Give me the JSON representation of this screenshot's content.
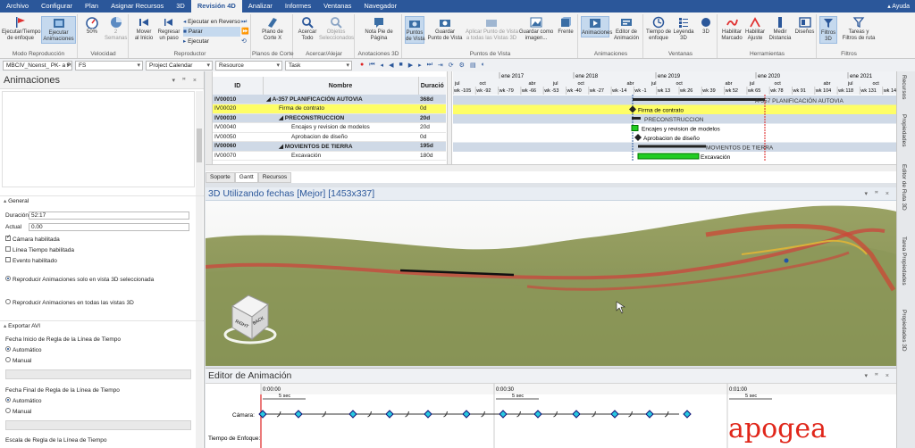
{
  "menu": {
    "items": [
      "Archivo",
      "Configurar",
      "Plan",
      "Asignar Recursos",
      "3D",
      "Revisión 4D",
      "Analizar",
      "Informes",
      "Ventanas",
      "Navegador"
    ],
    "active": "Revisión 4D",
    "help": "▴ Ayuda"
  },
  "ribbon": {
    "groups": {
      "modo": "Modo Reproducción",
      "velocidad": "Velocidad",
      "reproductor": "Reproductor",
      "planos": "Planos de Corte",
      "acercar": "Acercar/Alejar",
      "anotaciones": "Anotaciones 3D",
      "puntos": "Puntos de Vista",
      "animaciones": "Animaciones",
      "ventanas": "Ventanas",
      "herramientas": "Herramientas",
      "filtros": "Filtros"
    },
    "buttons": {
      "ejecutar_enfoque": "Ejecutar/Tiempo\nde enfoque",
      "ejecutar_anim": "Ejecutar\nAnimaciones",
      "vel_pct": "50%",
      "semanas": "2\nSemanas",
      "mover_inicio": "Mover\nal Inicio",
      "regresar": "Regresar\nun paso",
      "ejecutar_reverso": "Ejecutar en Reverso",
      "parar": "Parar",
      "ejecutar": "Ejecutar",
      "plano_corte": "Plano de\nCorte X",
      "acercar_todo": "Acercar\nTodo",
      "objetos_sel": "Objetos\nSeleccionados",
      "nota_pie": "Nota Pie de\nPágina",
      "puntos_vista": "Puntos\nde Vista",
      "guardar_pv": "Guardar\nPunto de Vista",
      "aplicar_pv": "Aplicar Punto de Vista\na todas las Vistas 3D",
      "guardar_imagen": "Guardar como\nimagen...",
      "frente": "Frente",
      "animaciones": "Animaciones",
      "editor_anim": "Editor de\nAnimación",
      "tiempo_leyenda": "Tiempo de\nenfoque",
      "leyenda": "Leyenda\n3D",
      "tres_d": "3D",
      "hab_marcado": "Habilitar\nMarcado",
      "hab_ajuste": "Habilitar\nAjuste",
      "medir": "Medir\nDistancia",
      "disenos": "Diseños",
      "filtros3d": "Filtros\n3D",
      "tareas_filtros": "Tareas y\nFiltros de ruta"
    }
  },
  "filterrow": {
    "project": "MBCIV_Ncenst_ PK- a PK",
    "fs": "FS",
    "calendar": "Project Calendar",
    "resource": "Resource",
    "task": "Task"
  },
  "left_panel": {
    "title": "Animaciones",
    "section_general": "General",
    "duracion_label": "Duración",
    "duracion_value": "52:17",
    "actual_label": "Actual",
    "actual_value": "0.00",
    "camara": "Cámara habilitada",
    "linea_tiempo": "Línea Tiempo habilitada",
    "evento": "Evento habilitado",
    "reproducir_sel": "Reproducir Animaciones solo en vista 3D seleccionada",
    "reproducir_todas": "Reproducir Animaciones en todas las vistas 3D",
    "section_export": "Exportar AVI",
    "fecha_inicio": "Fecha Inicio de Regla de la Línea de Tiempo",
    "automatico": "Automático",
    "manual": "Manual",
    "fecha_final": "Fecha Final de Regla de la Línea de Tiempo",
    "escala": "Escala de Regla de la Línea de Tiempo"
  },
  "gantt": {
    "col_id": "ID",
    "col_nombre": "Nombre",
    "col_duracion": "Duració",
    "rows": [
      {
        "id": "IV00010",
        "name": "A-357 PLANIFICACIÓN AUTOVIA",
        "dur": "368d",
        "level": 0,
        "type": "summary"
      },
      {
        "id": "IV00020",
        "name": "Firma de contrato",
        "dur": "0d",
        "level": 1,
        "type": "milestone"
      },
      {
        "id": "IV00030",
        "name": "PRECONSTRUCCION",
        "dur": "20d",
        "level": 1,
        "type": "summary"
      },
      {
        "id": "IV00040",
        "name": "Encajes y revision de modelos",
        "dur": "20d",
        "level": 2,
        "type": "task"
      },
      {
        "id": "IV00050",
        "name": "Aprobacion de diseño",
        "dur": "0d",
        "level": 2,
        "type": "milestone"
      },
      {
        "id": "IV00060",
        "name": "MOVIENTOS DE TIERRA",
        "dur": "195d",
        "level": 1,
        "type": "summary"
      },
      {
        "id": "IV00070",
        "name": "Excavación",
        "dur": "180d",
        "level": 2,
        "type": "task"
      }
    ],
    "tabs": [
      "Soporte",
      "Gantt",
      "Recursos"
    ],
    "active_tab": "Gantt",
    "timeline_years": [
      "ene 2017",
      "ene 2018",
      "ene 2019",
      "ene 2020",
      "ene 2021"
    ],
    "timeline_months": [
      "jul",
      "oct",
      "",
      "abr",
      "jul",
      "oct",
      "",
      "abr",
      "jul",
      "oct",
      "",
      "abr",
      "jul",
      "oct",
      "",
      "abr",
      "jul",
      "oct"
    ],
    "timeline_weeks": [
      "wk -105",
      "wk -92",
      "wk -79",
      "wk -66",
      "wk -53",
      "wk -40",
      "wk -27",
      "wk -14",
      "wk -1",
      "wk 13",
      "wk 26",
      "wk 39",
      "wk 52",
      "wk 65",
      "wk 78",
      "wk 91",
      "wk 104",
      "wk 118",
      "wk 131",
      "wk 144"
    ],
    "bar_labels": {
      "summary": "A-357 PLANIFICACIÓN AUTOVIA",
      "firma": "Firma de contrato",
      "precon": "PRECONSTRUCCION",
      "encajes": "Encajes y revision de modelos",
      "aprobacion": "Aprobacion de diseño",
      "movimientos": "MOVIENTOS DE TIERRA",
      "excavacion": "Excavación"
    }
  },
  "view3d": {
    "title": "3D Utilizando fechas [Mejor] [1453x337]",
    "cube_right": "RIGHT",
    "cube_back": "BACK"
  },
  "anim_editor": {
    "title": "Editor de Animación",
    "times": [
      "0:00:00",
      "0:00:30",
      "0:01:00"
    ],
    "interval": "5 sec",
    "camara_label": "Cámara:",
    "tiempo_label": "Tiempo de Enfoque:",
    "watermark": "apogea"
  },
  "right_tabs": [
    "Recursos",
    "Propiedades",
    "Editor de Ruta 3D",
    "Tarea Propiedades",
    "Propiedades 3D"
  ],
  "colors": {
    "accent": "#2b579a",
    "highlight_row": "#fefe66",
    "summary_row": "#cfd9e6",
    "bar_green": "#22cc22",
    "watermark": "#e0261a"
  }
}
